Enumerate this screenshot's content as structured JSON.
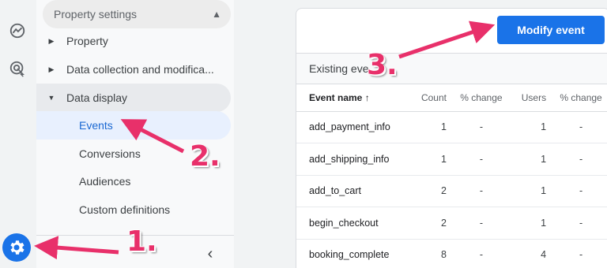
{
  "nav": {
    "header_label": "Property settings",
    "items": [
      {
        "label": "Property"
      },
      {
        "label": "Data collection and modifica..."
      },
      {
        "label": "Data display"
      }
    ],
    "sub_items": [
      {
        "label": "Events"
      },
      {
        "label": "Conversions"
      },
      {
        "label": "Audiences"
      },
      {
        "label": "Custom definitions"
      }
    ],
    "collapse_glyph": "‹"
  },
  "main": {
    "modify_button_label": "Modify event",
    "section_title": "Existing eve",
    "table": {
      "headers": [
        "Event name ↑",
        "Count",
        "% change",
        "Users",
        "% change"
      ],
      "rows": [
        [
          "add_payment_info",
          "1",
          "-",
          "1",
          "-"
        ],
        [
          "add_shipping_info",
          "1",
          "-",
          "1",
          "-"
        ],
        [
          "add_to_cart",
          "2",
          "-",
          "1",
          "-"
        ],
        [
          "begin_checkout",
          "2",
          "-",
          "1",
          "-"
        ],
        [
          "booking_complete",
          "8",
          "-",
          "4",
          "-"
        ]
      ]
    }
  },
  "annotations": {
    "step1": "1.",
    "step2": "2.",
    "step3": "3."
  },
  "colors": {
    "accent": "#1a73e8",
    "annotation": "#e8306a"
  },
  "icons": [
    "reports-icon",
    "advertising-icon",
    "gear-icon",
    "chevron-up-icon",
    "caret-right-icon",
    "caret-down-icon",
    "sort-arrow-up-icon"
  ]
}
